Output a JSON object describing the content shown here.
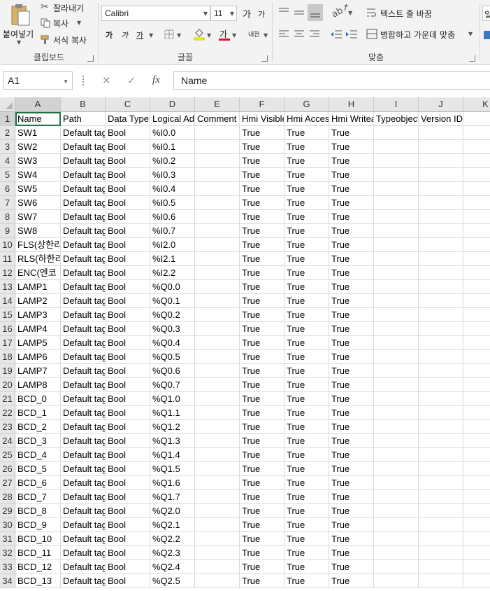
{
  "ribbon": {
    "clipboard": {
      "paste": "붙여넣기",
      "cut": "잘라내기",
      "copy": "복사",
      "format_painter": "서식 복사",
      "label": "클립보드"
    },
    "font": {
      "name": "Calibri",
      "size": "11",
      "grow": "가",
      "shrink": "가",
      "bold": "가",
      "italic": "가",
      "underline": "가",
      "font_color_glyph": "가",
      "phonetic": "내천",
      "label": "글꼴"
    },
    "alignment": {
      "wrap_text": "텍스트 줄 바꿈",
      "merge_center": "병합하고 가운데 맞춤",
      "label": "맞춤",
      "overflow": "일"
    }
  },
  "formula_bar": {
    "name_box": "A1",
    "cancel": "✕",
    "enter": "✓",
    "fx": "fx",
    "content": "Name"
  },
  "sheet": {
    "columns": [
      "A",
      "B",
      "C",
      "D",
      "E",
      "F",
      "G",
      "H",
      "I",
      "J",
      "K"
    ],
    "rows": [
      {
        "n": "1",
        "A": "Name",
        "B": "Path",
        "C": "Data Type",
        "D": "Logical Address",
        "E": "Comment",
        "F": "Hmi Visible",
        "G": "Hmi Accessible",
        "H": "Hmi Writeable",
        "I": "Typeobject ID",
        "J": "Version ID"
      },
      {
        "n": "2",
        "A": "SW1",
        "B": "Default tag table",
        "C": "Bool",
        "D": "%I0.0",
        "F": "True",
        "G": "True",
        "H": "True"
      },
      {
        "n": "3",
        "A": "SW2",
        "B": "Default tag table",
        "C": "Bool",
        "D": "%I0.1",
        "F": "True",
        "G": "True",
        "H": "True"
      },
      {
        "n": "4",
        "A": "SW3",
        "B": "Default tag table",
        "C": "Bool",
        "D": "%I0.2",
        "F": "True",
        "G": "True",
        "H": "True"
      },
      {
        "n": "5",
        "A": "SW4",
        "B": "Default tag table",
        "C": "Bool",
        "D": "%I0.3",
        "F": "True",
        "G": "True",
        "H": "True"
      },
      {
        "n": "6",
        "A": "SW5",
        "B": "Default tag table",
        "C": "Bool",
        "D": "%I0.4",
        "F": "True",
        "G": "True",
        "H": "True"
      },
      {
        "n": "7",
        "A": "SW6",
        "B": "Default tag table",
        "C": "Bool",
        "D": "%I0.5",
        "F": "True",
        "G": "True",
        "H": "True"
      },
      {
        "n": "8",
        "A": "SW7",
        "B": "Default tag table",
        "C": "Bool",
        "D": "%I0.6",
        "F": "True",
        "G": "True",
        "H": "True"
      },
      {
        "n": "9",
        "A": "SW8",
        "B": "Default tag table",
        "C": "Bool",
        "D": "%I0.7",
        "F": "True",
        "G": "True",
        "H": "True"
      },
      {
        "n": "10",
        "A": "FLS(상한리",
        "B": "Default tag table",
        "C": "Bool",
        "D": "%I2.0",
        "F": "True",
        "G": "True",
        "H": "True"
      },
      {
        "n": "11",
        "A": "RLS(하한리",
        "B": "Default tag table",
        "C": "Bool",
        "D": "%I2.1",
        "F": "True",
        "G": "True",
        "H": "True"
      },
      {
        "n": "12",
        "A": "ENC(엔코",
        "B": "Default tag table",
        "C": "Bool",
        "D": "%I2.2",
        "F": "True",
        "G": "True",
        "H": "True"
      },
      {
        "n": "13",
        "A": "LAMP1",
        "B": "Default tag table",
        "C": "Bool",
        "D": "%Q0.0",
        "F": "True",
        "G": "True",
        "H": "True"
      },
      {
        "n": "14",
        "A": "LAMP2",
        "B": "Default tag table",
        "C": "Bool",
        "D": "%Q0.1",
        "F": "True",
        "G": "True",
        "H": "True"
      },
      {
        "n": "15",
        "A": "LAMP3",
        "B": "Default tag table",
        "C": "Bool",
        "D": "%Q0.2",
        "F": "True",
        "G": "True",
        "H": "True"
      },
      {
        "n": "16",
        "A": "LAMP4",
        "B": "Default tag table",
        "C": "Bool",
        "D": "%Q0.3",
        "F": "True",
        "G": "True",
        "H": "True"
      },
      {
        "n": "17",
        "A": "LAMP5",
        "B": "Default tag table",
        "C": "Bool",
        "D": "%Q0.4",
        "F": "True",
        "G": "True",
        "H": "True"
      },
      {
        "n": "18",
        "A": "LAMP6",
        "B": "Default tag table",
        "C": "Bool",
        "D": "%Q0.5",
        "F": "True",
        "G": "True",
        "H": "True"
      },
      {
        "n": "19",
        "A": "LAMP7",
        "B": "Default tag table",
        "C": "Bool",
        "D": "%Q0.6",
        "F": "True",
        "G": "True",
        "H": "True"
      },
      {
        "n": "20",
        "A": "LAMP8",
        "B": "Default tag table",
        "C": "Bool",
        "D": "%Q0.7",
        "F": "True",
        "G": "True",
        "H": "True"
      },
      {
        "n": "21",
        "A": "BCD_0",
        "B": "Default tag table",
        "C": "Bool",
        "D": "%Q1.0",
        "F": "True",
        "G": "True",
        "H": "True"
      },
      {
        "n": "22",
        "A": "BCD_1",
        "B": "Default tag table",
        "C": "Bool",
        "D": "%Q1.1",
        "F": "True",
        "G": "True",
        "H": "True"
      },
      {
        "n": "23",
        "A": "BCD_2",
        "B": "Default tag table",
        "C": "Bool",
        "D": "%Q1.2",
        "F": "True",
        "G": "True",
        "H": "True"
      },
      {
        "n": "24",
        "A": "BCD_3",
        "B": "Default tag table",
        "C": "Bool",
        "D": "%Q1.3",
        "F": "True",
        "G": "True",
        "H": "True"
      },
      {
        "n": "25",
        "A": "BCD_4",
        "B": "Default tag table",
        "C": "Bool",
        "D": "%Q1.4",
        "F": "True",
        "G": "True",
        "H": "True"
      },
      {
        "n": "26",
        "A": "BCD_5",
        "B": "Default tag table",
        "C": "Bool",
        "D": "%Q1.5",
        "F": "True",
        "G": "True",
        "H": "True"
      },
      {
        "n": "27",
        "A": "BCD_6",
        "B": "Default tag table",
        "C": "Bool",
        "D": "%Q1.6",
        "F": "True",
        "G": "True",
        "H": "True"
      },
      {
        "n": "28",
        "A": "BCD_7",
        "B": "Default tag table",
        "C": "Bool",
        "D": "%Q1.7",
        "F": "True",
        "G": "True",
        "H": "True"
      },
      {
        "n": "29",
        "A": "BCD_8",
        "B": "Default tag table",
        "C": "Bool",
        "D": "%Q2.0",
        "F": "True",
        "G": "True",
        "H": "True"
      },
      {
        "n": "30",
        "A": "BCD_9",
        "B": "Default tag table",
        "C": "Bool",
        "D": "%Q2.1",
        "F": "True",
        "G": "True",
        "H": "True"
      },
      {
        "n": "31",
        "A": "BCD_10",
        "B": "Default tag table",
        "C": "Bool",
        "D": "%Q2.2",
        "F": "True",
        "G": "True",
        "H": "True"
      },
      {
        "n": "32",
        "A": "BCD_11",
        "B": "Default tag table",
        "C": "Bool",
        "D": "%Q2.3",
        "F": "True",
        "G": "True",
        "H": "True"
      },
      {
        "n": "33",
        "A": "BCD_12",
        "B": "Default tag table",
        "C": "Bool",
        "D": "%Q2.4",
        "F": "True",
        "G": "True",
        "H": "True"
      },
      {
        "n": "34",
        "A": "BCD_13",
        "B": "Default tag table",
        "C": "Bool",
        "D": "%Q2.5",
        "F": "True",
        "G": "True",
        "H": "True"
      }
    ]
  },
  "colors": {
    "accent": "#217346",
    "font_color_bar": "#e81123"
  }
}
